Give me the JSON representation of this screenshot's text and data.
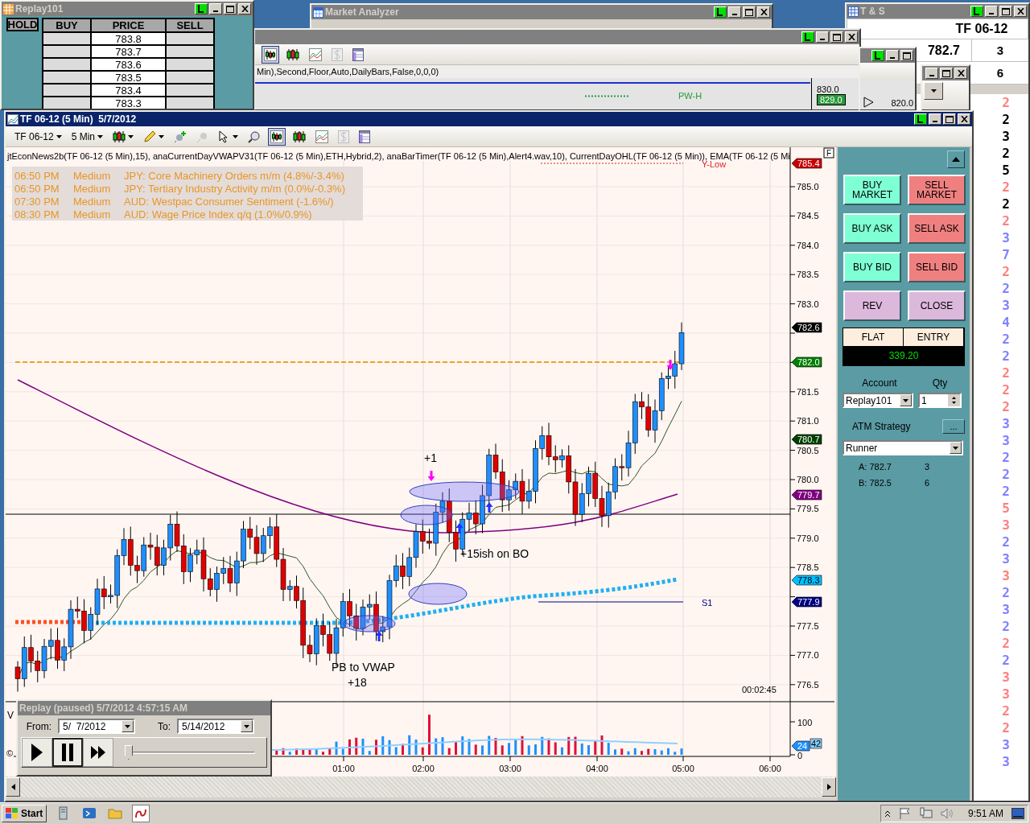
{
  "dom": {
    "title": "Replay101",
    "columns": [
      "HOLD",
      "BUY",
      "PRICE",
      "SELL"
    ],
    "prices": [
      "783.8",
      "783.7",
      "783.6",
      "783.5",
      "783.4",
      "783.3"
    ]
  },
  "market_analyzer": {
    "title": "Market Analyzer"
  },
  "background_chart": {
    "indicator_text": "Min),Second,Floor,Auto,DailyBars,False,0,0,0)",
    "level_label": "PW-H",
    "axis_label": "830.0",
    "price_marker": "829.0"
  },
  "small_chart": {
    "axis_label": "820.0"
  },
  "time_and_sales": {
    "title": "T & S",
    "instrument": "TF 06-12",
    "quotes": [
      {
        "price": "782.7",
        "size": "3"
      },
      {
        "size": "6"
      }
    ],
    "trades": [
      {
        "size": "2",
        "color": "#ff7f7f"
      },
      {
        "size": "2",
        "color": "#000000"
      },
      {
        "size": "3",
        "color": "#000000"
      },
      {
        "size": "2",
        "color": "#000000"
      },
      {
        "size": "5",
        "color": "#000000"
      },
      {
        "size": "2",
        "color": "#ff7f7f"
      },
      {
        "size": "2",
        "color": "#000000"
      },
      {
        "size": "2",
        "color": "#ff7f7f"
      },
      {
        "size": "3",
        "color": "#8080ff"
      },
      {
        "size": "7",
        "color": "#8080ff"
      },
      {
        "size": "2",
        "color": "#ff7f7f"
      },
      {
        "size": "2",
        "color": "#8080ff"
      },
      {
        "size": "3",
        "color": "#8080ff"
      },
      {
        "size": "4",
        "color": "#8080ff"
      },
      {
        "size": "2",
        "color": "#8080ff"
      },
      {
        "size": "2",
        "color": "#8080ff"
      },
      {
        "size": "2",
        "color": "#ff7f7f"
      },
      {
        "size": "2",
        "color": "#ff7f7f"
      },
      {
        "size": "2",
        "color": "#ff7f7f"
      },
      {
        "size": "3",
        "color": "#8080ff"
      },
      {
        "size": "3",
        "color": "#8080ff"
      },
      {
        "size": "2",
        "color": "#8080ff"
      },
      {
        "size": "2",
        "color": "#8080ff"
      },
      {
        "size": "2",
        "color": "#8080ff"
      },
      {
        "size": "5",
        "color": "#ff7f7f"
      },
      {
        "size": "3",
        "color": "#ff7f7f"
      },
      {
        "size": "2",
        "color": "#8080ff"
      },
      {
        "size": "3",
        "color": "#8080ff"
      },
      {
        "size": "3",
        "color": "#ff7f7f"
      },
      {
        "size": "2",
        "color": "#8080ff"
      },
      {
        "size": "3",
        "color": "#8080ff"
      },
      {
        "size": "2",
        "color": "#8080ff"
      },
      {
        "size": "2",
        "color": "#ff7f7f"
      },
      {
        "size": "2",
        "color": "#8080ff"
      },
      {
        "size": "3",
        "color": "#ff7f7f"
      },
      {
        "size": "3",
        "color": "#ff7f7f"
      },
      {
        "size": "2",
        "color": "#ff7f7f"
      },
      {
        "size": "2",
        "color": "#ff7f7f"
      },
      {
        "size": "3",
        "color": "#8080ff"
      },
      {
        "size": "3",
        "color": "#8080ff"
      }
    ]
  },
  "chart": {
    "title": "TF 06-12 (5 Min)  5/7/2012",
    "instrument": "TF 06-12",
    "interval": "5 Min",
    "indicators": "jtEconNews2b(TF 06-12 (5 Min),15), anaCurrentDayVWAPV31(TF 06-12 (5 Min),ETH,Hybrid,2), anaBarTimer(TF 06-12 (5 Min),Alert4.wav,10), CurrentDayOHL(TF 06-12 (5 Min)), EMA(TF 06-12 (5 Mi",
    "panel_toggle": "F",
    "news": [
      {
        "time": "06:50 PM",
        "impact": "Medium",
        "event": "JPY: Core Machinery Orders m/m (4.8%/-3.4%)"
      },
      {
        "time": "06:50 PM",
        "impact": "Medium",
        "event": "JPY: Tertiary Industry Activity m/m (0.0%/-0.3%)"
      },
      {
        "time": "07:30 PM",
        "impact": "Medium",
        "event": "AUD: Westpac Consumer Sentiment (-1.6%/)"
      },
      {
        "time": "08:30 PM",
        "impact": "Medium",
        "event": "AUD: Wage Price Index q/q (1.0%/0.9%)"
      }
    ],
    "price_axis": [
      "785.0",
      "784.5",
      "784.0",
      "783.5",
      "783.0",
      "781.5",
      "781.0",
      "780.5",
      "780.0",
      "779.5",
      "779.0",
      "778.5",
      "777.5",
      "777.0",
      "776.5"
    ],
    "price_markers": [
      {
        "value": "785.4",
        "color": "#cc0000"
      },
      {
        "value": "782.6",
        "color": "#000000"
      },
      {
        "value": "782.0",
        "color": "#008000"
      },
      {
        "value": "780.7",
        "color": "#004000"
      },
      {
        "value": "779.7",
        "color": "#800080"
      },
      {
        "value": "778.3",
        "color": "#00bfff"
      },
      {
        "value": "777.9",
        "color": "#000080"
      }
    ],
    "annotations": [
      "+1",
      "+15ish on BO",
      "PB to VWAP",
      "+18"
    ],
    "level_labels": [
      "Y-Low",
      "S1"
    ],
    "bar_timer": "00:02:45",
    "volume_label": "V",
    "copyright": "©",
    "volume_axis": [
      "100",
      "0"
    ],
    "volume_markers": [
      {
        "value": "24",
        "color": "#1e90ff"
      },
      {
        "value": "42",
        "color": "#87cefa"
      }
    ],
    "time_axis": [
      "01:00",
      "02:00",
      "03:00",
      "04:00",
      "05:00",
      "06:00"
    ]
  },
  "order_panel": {
    "buttons": [
      {
        "label": "BUY MARKET",
        "kind": "buy"
      },
      {
        "label": "SELL MARKET",
        "kind": "sell"
      },
      {
        "label": "BUY ASK",
        "kind": "buy"
      },
      {
        "label": "SELL ASK",
        "kind": "sell"
      },
      {
        "label": "BUY BID",
        "kind": "buy"
      },
      {
        "label": "SELL BID",
        "kind": "sell"
      },
      {
        "label": "REV",
        "kind": "neutral"
      },
      {
        "label": "CLOSE",
        "kind": "neutral"
      }
    ],
    "position": "FLAT",
    "entry_label": "ENTRY",
    "pnl": "339.20",
    "account_label": "Account",
    "qty_label": "Qty",
    "account": "Replay101",
    "qty": "1",
    "atm_label": "ATM Strategy",
    "atm_button": "...",
    "strategy": "Runner",
    "ask": "A: 782.7",
    "ask_size": "3",
    "bid": "B: 782.5",
    "bid_size": "6"
  },
  "replay": {
    "title": "Replay (paused) 5/7/2012 4:57:15 AM",
    "from_label": "From:",
    "from": "5/  7/2012",
    "to_label": "To:",
    "to": "5/14/2012",
    "controls": [
      {
        "kind": "play",
        "selected": false
      },
      {
        "kind": "pause",
        "selected": true
      },
      {
        "kind": "fast_forward",
        "selected": false
      }
    ],
    "position": {
      "level": 0.03
    }
  },
  "taskbar": {
    "start": "Start",
    "clock": "9:51 AM"
  }
}
